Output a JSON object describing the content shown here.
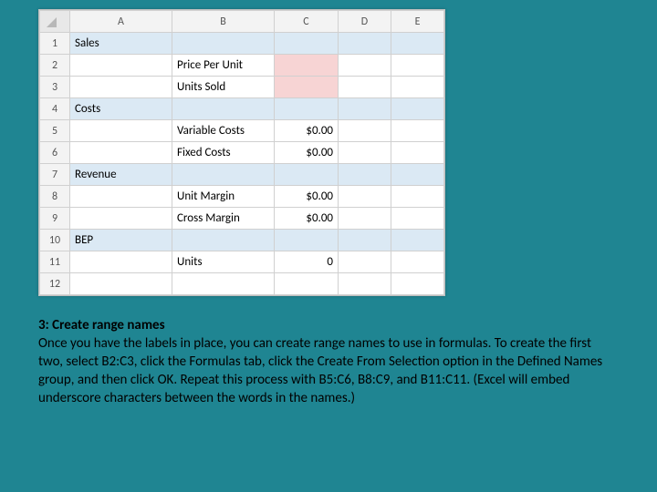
{
  "sheet": {
    "columns": [
      "A",
      "B",
      "C",
      "D",
      "E"
    ],
    "rows": [
      "1",
      "2",
      "3",
      "4",
      "5",
      "6",
      "7",
      "8",
      "9",
      "10",
      "11",
      "12"
    ],
    "cells": {
      "A1": "Sales",
      "B2": "Price Per Unit",
      "B3": "Units Sold",
      "A4": "Costs",
      "B5": "Variable Costs",
      "C5": "$0.00",
      "B6": "Fixed Costs",
      "C6": "$0.00",
      "A7": "Revenue",
      "B8": "Unit Margin",
      "C8": "$0.00",
      "B9": "Cross Margin",
      "C9": "$0.00",
      "A10": "BEP",
      "B11": "Units",
      "C11": "0"
    }
  },
  "instructions": {
    "heading": "3: Create range names",
    "body": "Once you have the labels in place, you can create range names to use in formulas. To create the first two, select B2:C3, click the Formulas tab, click the Create From Selection option in the Defined Names group, and then click OK. Repeat this process with B5:C6, B8:C9, and B11:C11. (Excel will embed underscore characters between the words in the names.)"
  }
}
